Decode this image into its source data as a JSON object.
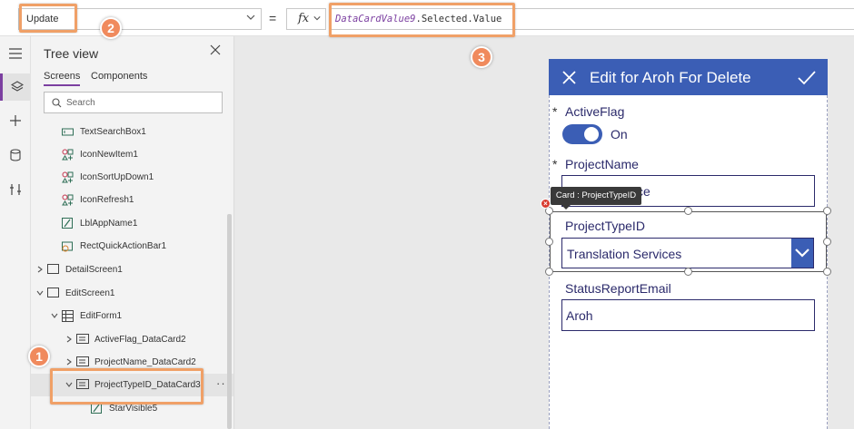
{
  "formula_bar": {
    "property": "Update",
    "equals": "=",
    "fx_label": "fx",
    "formula_ref": "DataCardValue9",
    "formula_rest": ".Selected.Value"
  },
  "tree_view": {
    "title": "Tree view",
    "tabs": [
      "Screens",
      "Components"
    ],
    "search_placeholder": "Search",
    "items": [
      {
        "label": "TextSearchBox1",
        "icon": "text-input-icon"
      },
      {
        "label": "IconNewItem1",
        "icon": "icon-control-icon"
      },
      {
        "label": "IconSortUpDown1",
        "icon": "icon-control-icon"
      },
      {
        "label": "IconRefresh1",
        "icon": "icon-control-icon"
      },
      {
        "label": "LblAppName1",
        "icon": "label-icon"
      },
      {
        "label": "RectQuickActionBar1",
        "icon": "rectangle-icon"
      },
      {
        "label": "DetailScreen1",
        "icon": "screen-icon"
      },
      {
        "label": "EditScreen1",
        "icon": "screen-icon"
      },
      {
        "label": "EditForm1",
        "icon": "form-icon"
      },
      {
        "label": "ActiveFlag_DataCard2",
        "icon": "card-icon"
      },
      {
        "label": "ProjectName_DataCard2",
        "icon": "card-icon"
      },
      {
        "label": "ProjectTypeID_DataCard3",
        "icon": "card-icon"
      },
      {
        "label": "StarVisible5",
        "icon": "label-icon"
      }
    ],
    "more_label": "···"
  },
  "callouts": [
    "1",
    "2",
    "3"
  ],
  "form": {
    "title": "Edit for Aroh For Delete",
    "required_mark": "*",
    "active_flag_label": "ActiveFlag",
    "active_flag_value": "On",
    "project_name_label": "ProjectName",
    "project_name_value": "ce",
    "tooltip": "Card : ProjectTypeID",
    "project_type_label": "ProjectTypeID",
    "project_type_value": "Translation Services",
    "status_email_label": "StatusReportEmail",
    "status_email_value": "Aroh"
  },
  "colors": {
    "accent_purple": "#7b3fa0",
    "form_header": "#3b5eb5",
    "field_text": "#2b2a6b",
    "callout": "#f08a5d"
  }
}
